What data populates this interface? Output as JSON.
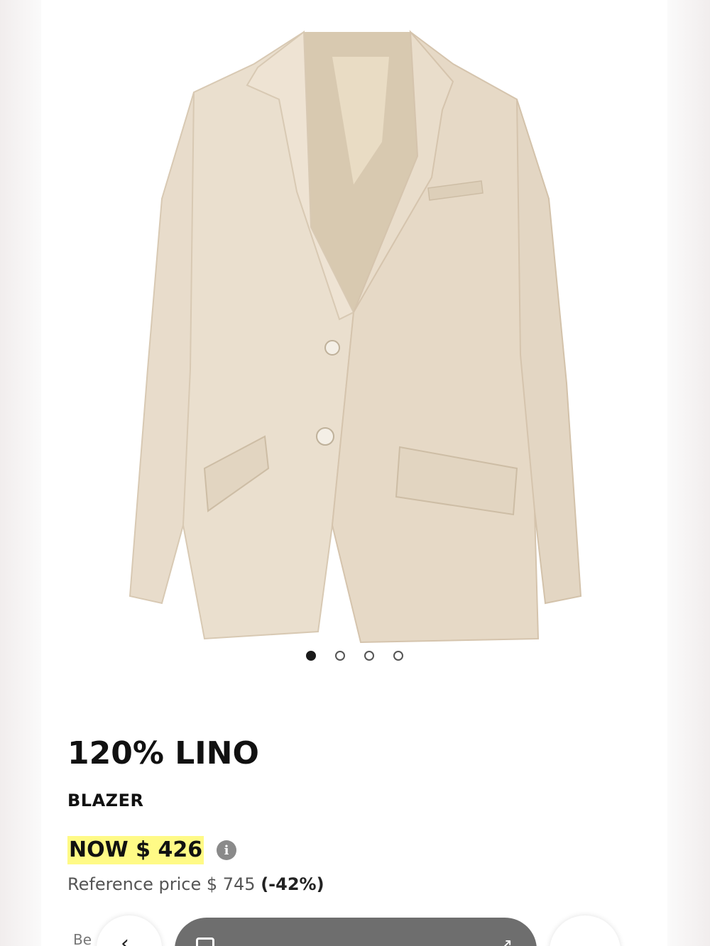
{
  "product": {
    "brand": "120% LINO",
    "category": "BLAZER",
    "price_now": "NOW $ 426",
    "reference_label": "Reference price $ 745",
    "discount": "(-42%)"
  },
  "gallery": {
    "image_count": 4,
    "active_index": 0
  },
  "footer": {
    "peek_text": "Be"
  },
  "icons": {
    "info": "info-icon",
    "back": "chevron-left-icon",
    "tabs": "tabs-icon",
    "share": "share-icon"
  }
}
